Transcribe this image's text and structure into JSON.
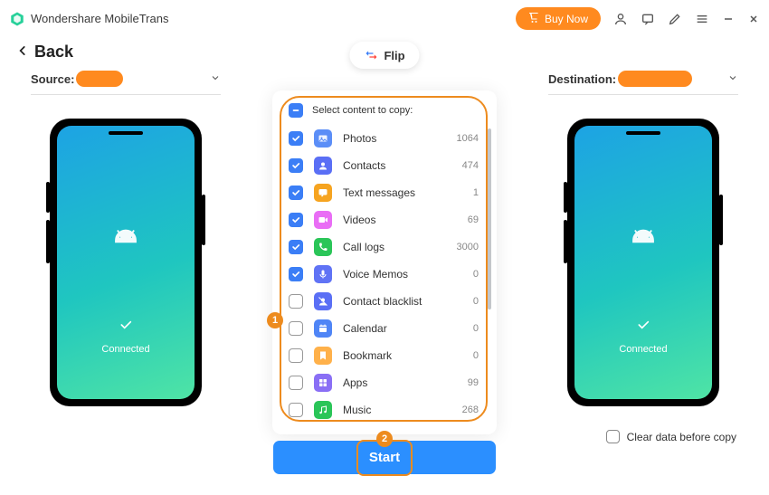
{
  "app_title": "Wondershare MobileTrans",
  "buy_now": "Buy Now",
  "back_label": "Back",
  "flip_label": "Flip",
  "source_label": "Source:",
  "destination_label": "Destination:",
  "connected_label": "Connected",
  "selectall_label": "Select content to copy:",
  "content": [
    {
      "name": "photos",
      "label": "Photos",
      "count": 1064,
      "checked": true,
      "icon_bg": "#5b8ef7"
    },
    {
      "name": "contacts",
      "label": "Contacts",
      "count": 474,
      "checked": true,
      "icon_bg": "#5a6ff5"
    },
    {
      "name": "textmessages",
      "label": "Text messages",
      "count": 1,
      "checked": true,
      "icon_bg": "#f6a420"
    },
    {
      "name": "videos",
      "label": "Videos",
      "count": 69,
      "checked": true,
      "icon_bg": "#e96df5"
    },
    {
      "name": "calllogs",
      "label": "Call logs",
      "count": 3000,
      "checked": true,
      "icon_bg": "#2ac558"
    },
    {
      "name": "voicememos",
      "label": "Voice Memos",
      "count": 0,
      "checked": true,
      "icon_bg": "#6073f5"
    },
    {
      "name": "blacklist",
      "label": "Contact blacklist",
      "count": 0,
      "checked": false,
      "icon_bg": "#5a6ff5"
    },
    {
      "name": "calendar",
      "label": "Calendar",
      "count": 0,
      "checked": false,
      "icon_bg": "#4f85f6"
    },
    {
      "name": "bookmark",
      "label": "Bookmark",
      "count": 0,
      "checked": false,
      "icon_bg": "#ffb14a"
    },
    {
      "name": "apps",
      "label": "Apps",
      "count": 99,
      "checked": false,
      "icon_bg": "#8a6ff5"
    },
    {
      "name": "music",
      "label": "Music",
      "count": 268,
      "checked": false,
      "icon_bg": "#2ac558"
    }
  ],
  "start_label": "Start",
  "clear_label": "Clear data before copy",
  "annotations": {
    "one": "1",
    "two": "2"
  }
}
